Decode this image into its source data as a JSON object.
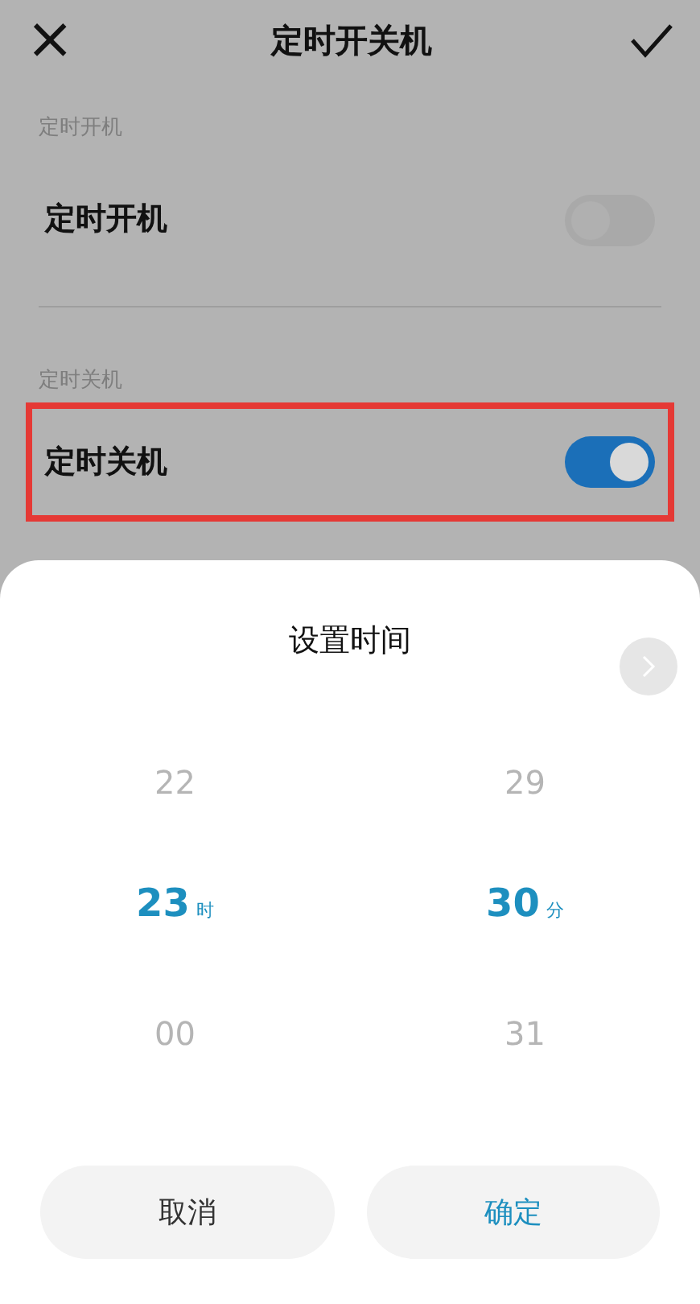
{
  "header": {
    "close": "×",
    "title": "定时开关机"
  },
  "sections": [
    {
      "label": "定时开机",
      "row": {
        "title": "定时开机",
        "on": false,
        "highlighted": false
      }
    },
    {
      "label": "定时关机",
      "row": {
        "title": "定时关机",
        "on": true,
        "highlighted": true
      }
    }
  ],
  "sheet": {
    "title": "设置时间",
    "columns": [
      {
        "unit": "时",
        "items": [
          {
            "value": "22",
            "selected": false
          },
          {
            "value": "23",
            "selected": true
          },
          {
            "value": "00",
            "selected": false
          }
        ]
      },
      {
        "unit": "分",
        "items": [
          {
            "value": "29",
            "selected": false
          },
          {
            "value": "30",
            "selected": true
          },
          {
            "value": "31",
            "selected": false
          }
        ]
      }
    ],
    "buttons": [
      {
        "label": "取消",
        "kind": "cancel"
      },
      {
        "label": "确定",
        "kind": "confirm"
      }
    ]
  }
}
